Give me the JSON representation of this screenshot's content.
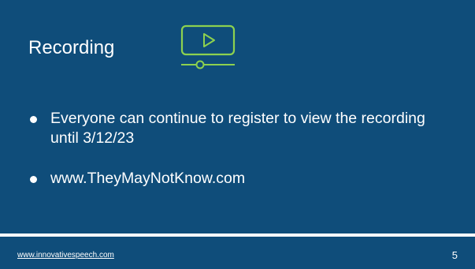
{
  "slide": {
    "title": "Recording",
    "bullets": [
      "Everyone can continue to register to view the recording until 3/12/23",
      "www.TheyMayNotKnow.com"
    ],
    "icon": "video-play-icon",
    "footer": {
      "link": "www.innovativespeech.com",
      "page_number": "5"
    },
    "colors": {
      "background": "#0f4d7a",
      "accent": "#8dd14f",
      "text": "#ffffff"
    }
  }
}
